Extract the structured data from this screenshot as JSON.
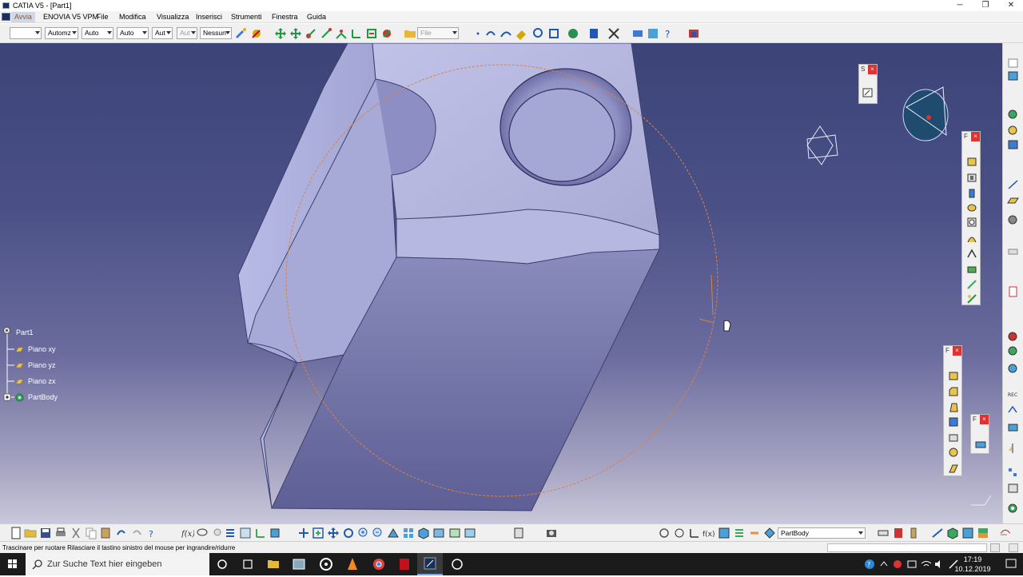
{
  "window": {
    "title": "CATIA V5 - [Part1]",
    "controls": [
      "─",
      "❐",
      "✕"
    ]
  },
  "menu": {
    "items": [
      "Avvia",
      "ENOVIA V5 VPM",
      "File",
      "Modifica",
      "Visualizza",
      "Inserisci",
      "Strumenti",
      "Finestra",
      "Guida"
    ]
  },
  "toolbar": {
    "combos": [
      "",
      "Automz",
      "Auto",
      "Auto",
      "Aut",
      "Aut",
      "Nessun"
    ],
    "file_filter": "File"
  },
  "tree": {
    "root": "Part1",
    "children": [
      "Piano xy",
      "Piano yz",
      "Piano zx",
      "PartBody"
    ]
  },
  "palettes": {
    "sketch": {
      "label": "S"
    },
    "features": {
      "label": "F"
    },
    "dress_up": {
      "label": "F"
    },
    "surface": {
      "label": "F"
    }
  },
  "bottom_toolbar": {
    "current_body": "PartBody"
  },
  "status": {
    "message": "Trascinare per ruotare  Rilasciare il tastino sinistro del mouse per ingrandire/ridurre"
  },
  "taskbar": {
    "search_placeholder": "Zur Suche Text hier eingeben",
    "time": "17:19",
    "date": "10.12.2019"
  },
  "colors": {
    "viewport_top": "#3b4377",
    "viewport_bottom": "#c9c7d9",
    "part_face": "#b4b6de",
    "rotation_circle": "#e08040"
  }
}
